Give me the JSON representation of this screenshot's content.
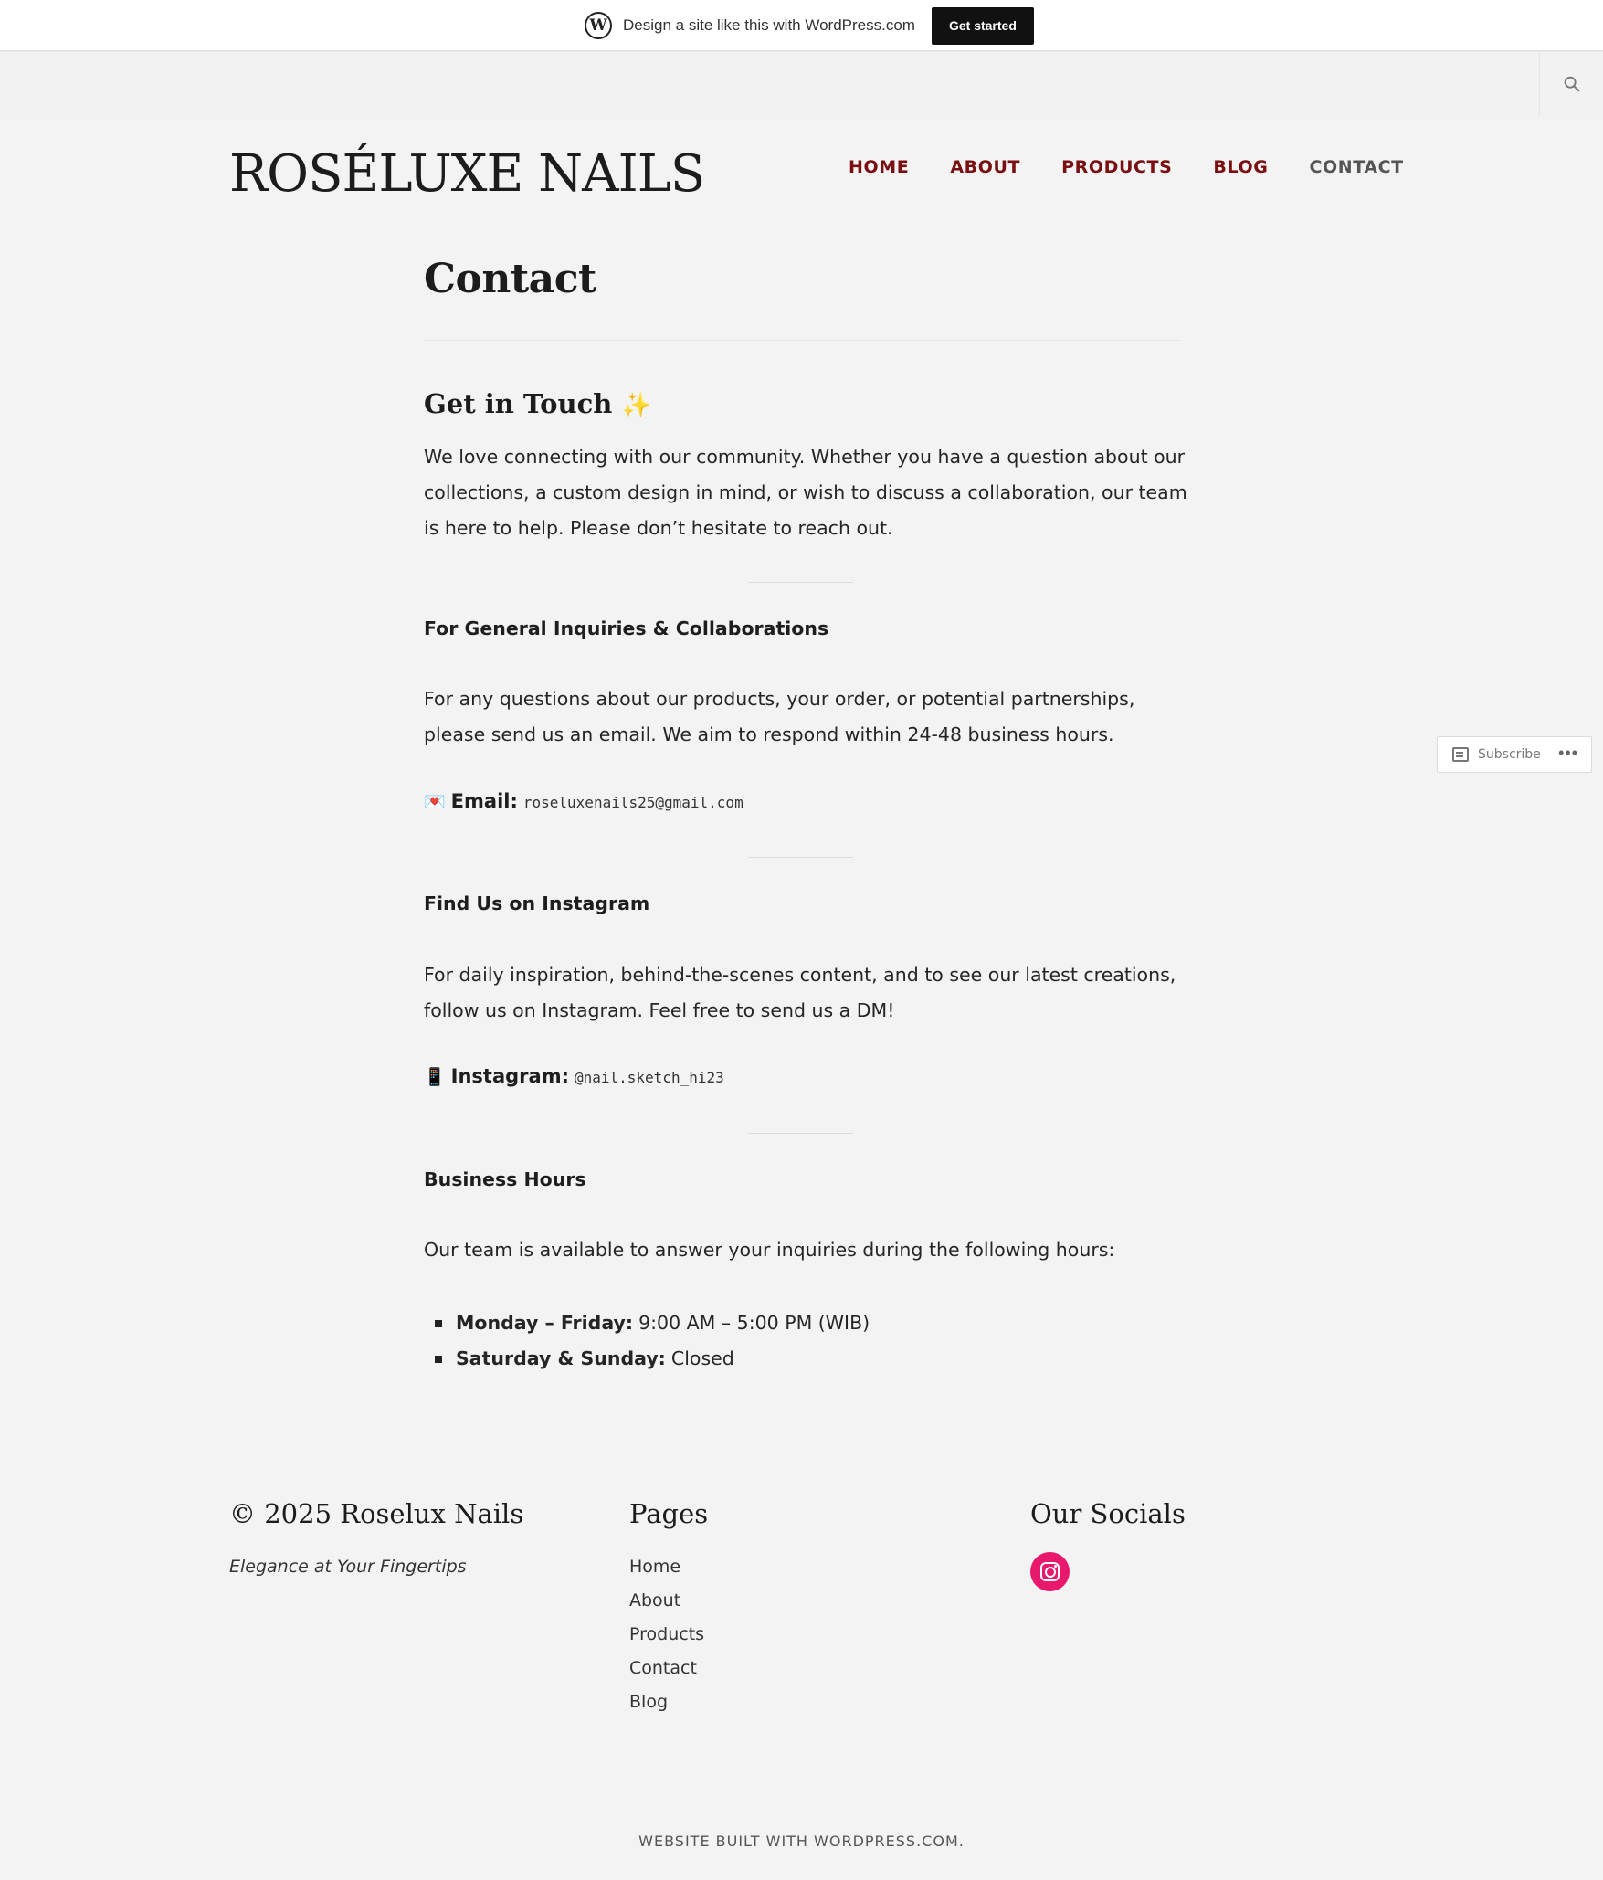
{
  "wpbar": {
    "logo_glyph": "W",
    "text": "Design a site like this with WordPress.com",
    "button_label": "Get started"
  },
  "header": {
    "site_title": "ROSÉLUXE NAILS",
    "nav": [
      {
        "label": "HOME"
      },
      {
        "label": "ABOUT"
      },
      {
        "label": "PRODUCTS"
      },
      {
        "label": "BLOG"
      },
      {
        "label": "CONTACT"
      }
    ],
    "accent_color": "#7a0f12",
    "active_nav": "CONTACT"
  },
  "main": {
    "page_title": "Contact",
    "intro_heading": "Get in Touch",
    "intro_emoji": "✨",
    "intro_text": "We love connecting with our community. Whether you have a question about our collections, a custom design in mind, or wish to discuss a collaboration, our team is here to help. Please don’t hesitate to reach out.",
    "general": {
      "heading": "For General Inquiries & Collaborations",
      "text": "For any questions about our products, your order, or potential partnerships, please send us an email. We aim to respond within 24-48 business hours.",
      "emoji": "💌",
      "label": "Email:",
      "value": "roseluxenails25@gmail.com"
    },
    "instagram": {
      "heading": "Find Us on Instagram",
      "text": "For daily inspiration, behind-the-scenes content, and to see our latest creations, follow us on Instagram. Feel free to send us a DM!",
      "emoji": "📱",
      "label": "Instagram:",
      "value": "@nail.sketch_hi23"
    },
    "hours": {
      "heading": "Business Hours",
      "text": "Our team is available to answer your inquiries during the following hours:",
      "items": [
        {
          "label": "Monday – Friday:",
          "value": "9:00 AM – 5:00 PM (WIB)"
        },
        {
          "label": "Saturday & Sunday:",
          "value": "Closed"
        }
      ]
    }
  },
  "subscribe": {
    "label": "Subscribe",
    "more": "•••"
  },
  "footer": {
    "copyright": "© 2025 Roselux Nails",
    "tagline": "Elegance at Your Fingertips",
    "pages_heading": "Pages",
    "pages": [
      "Home",
      "About",
      "Products",
      "Contact",
      "Blog"
    ],
    "socials_heading": "Our Socials",
    "socials": [
      {
        "icon": "instagram-icon",
        "color": "#e8186d"
      }
    ],
    "built_with": "WEBSITE BUILT WITH WORDPRESS.COM."
  }
}
